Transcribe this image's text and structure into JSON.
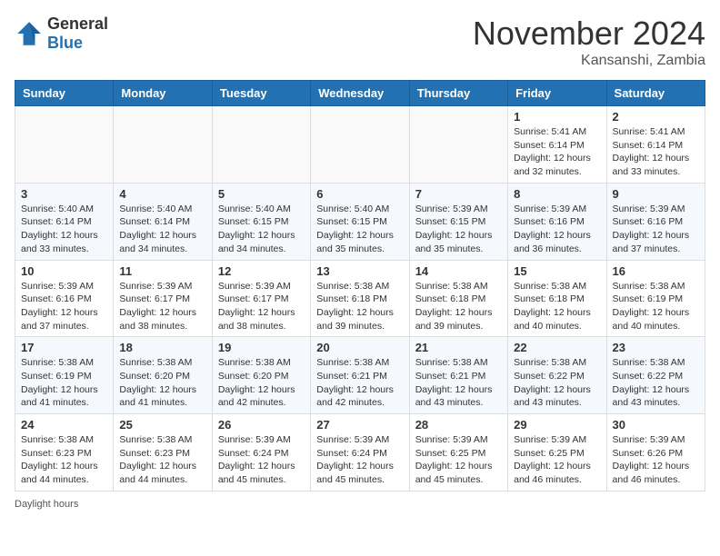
{
  "header": {
    "logo_general": "General",
    "logo_blue": "Blue",
    "month_year": "November 2024",
    "location": "Kansanshi, Zambia"
  },
  "days_of_week": [
    "Sunday",
    "Monday",
    "Tuesday",
    "Wednesday",
    "Thursday",
    "Friday",
    "Saturday"
  ],
  "footer": {
    "note": "Daylight hours"
  },
  "weeks": [
    [
      {
        "day": "",
        "info": ""
      },
      {
        "day": "",
        "info": ""
      },
      {
        "day": "",
        "info": ""
      },
      {
        "day": "",
        "info": ""
      },
      {
        "day": "",
        "info": ""
      },
      {
        "day": "1",
        "info": "Sunrise: 5:41 AM\nSunset: 6:14 PM\nDaylight: 12 hours and 32 minutes."
      },
      {
        "day": "2",
        "info": "Sunrise: 5:41 AM\nSunset: 6:14 PM\nDaylight: 12 hours and 33 minutes."
      }
    ],
    [
      {
        "day": "3",
        "info": "Sunrise: 5:40 AM\nSunset: 6:14 PM\nDaylight: 12 hours and 33 minutes."
      },
      {
        "day": "4",
        "info": "Sunrise: 5:40 AM\nSunset: 6:14 PM\nDaylight: 12 hours and 34 minutes."
      },
      {
        "day": "5",
        "info": "Sunrise: 5:40 AM\nSunset: 6:15 PM\nDaylight: 12 hours and 34 minutes."
      },
      {
        "day": "6",
        "info": "Sunrise: 5:40 AM\nSunset: 6:15 PM\nDaylight: 12 hours and 35 minutes."
      },
      {
        "day": "7",
        "info": "Sunrise: 5:39 AM\nSunset: 6:15 PM\nDaylight: 12 hours and 35 minutes."
      },
      {
        "day": "8",
        "info": "Sunrise: 5:39 AM\nSunset: 6:16 PM\nDaylight: 12 hours and 36 minutes."
      },
      {
        "day": "9",
        "info": "Sunrise: 5:39 AM\nSunset: 6:16 PM\nDaylight: 12 hours and 37 minutes."
      }
    ],
    [
      {
        "day": "10",
        "info": "Sunrise: 5:39 AM\nSunset: 6:16 PM\nDaylight: 12 hours and 37 minutes."
      },
      {
        "day": "11",
        "info": "Sunrise: 5:39 AM\nSunset: 6:17 PM\nDaylight: 12 hours and 38 minutes."
      },
      {
        "day": "12",
        "info": "Sunrise: 5:39 AM\nSunset: 6:17 PM\nDaylight: 12 hours and 38 minutes."
      },
      {
        "day": "13",
        "info": "Sunrise: 5:38 AM\nSunset: 6:18 PM\nDaylight: 12 hours and 39 minutes."
      },
      {
        "day": "14",
        "info": "Sunrise: 5:38 AM\nSunset: 6:18 PM\nDaylight: 12 hours and 39 minutes."
      },
      {
        "day": "15",
        "info": "Sunrise: 5:38 AM\nSunset: 6:18 PM\nDaylight: 12 hours and 40 minutes."
      },
      {
        "day": "16",
        "info": "Sunrise: 5:38 AM\nSunset: 6:19 PM\nDaylight: 12 hours and 40 minutes."
      }
    ],
    [
      {
        "day": "17",
        "info": "Sunrise: 5:38 AM\nSunset: 6:19 PM\nDaylight: 12 hours and 41 minutes."
      },
      {
        "day": "18",
        "info": "Sunrise: 5:38 AM\nSunset: 6:20 PM\nDaylight: 12 hours and 41 minutes."
      },
      {
        "day": "19",
        "info": "Sunrise: 5:38 AM\nSunset: 6:20 PM\nDaylight: 12 hours and 42 minutes."
      },
      {
        "day": "20",
        "info": "Sunrise: 5:38 AM\nSunset: 6:21 PM\nDaylight: 12 hours and 42 minutes."
      },
      {
        "day": "21",
        "info": "Sunrise: 5:38 AM\nSunset: 6:21 PM\nDaylight: 12 hours and 43 minutes."
      },
      {
        "day": "22",
        "info": "Sunrise: 5:38 AM\nSunset: 6:22 PM\nDaylight: 12 hours and 43 minutes."
      },
      {
        "day": "23",
        "info": "Sunrise: 5:38 AM\nSunset: 6:22 PM\nDaylight: 12 hours and 43 minutes."
      }
    ],
    [
      {
        "day": "24",
        "info": "Sunrise: 5:38 AM\nSunset: 6:23 PM\nDaylight: 12 hours and 44 minutes."
      },
      {
        "day": "25",
        "info": "Sunrise: 5:38 AM\nSunset: 6:23 PM\nDaylight: 12 hours and 44 minutes."
      },
      {
        "day": "26",
        "info": "Sunrise: 5:39 AM\nSunset: 6:24 PM\nDaylight: 12 hours and 45 minutes."
      },
      {
        "day": "27",
        "info": "Sunrise: 5:39 AM\nSunset: 6:24 PM\nDaylight: 12 hours and 45 minutes."
      },
      {
        "day": "28",
        "info": "Sunrise: 5:39 AM\nSunset: 6:25 PM\nDaylight: 12 hours and 45 minutes."
      },
      {
        "day": "29",
        "info": "Sunrise: 5:39 AM\nSunset: 6:25 PM\nDaylight: 12 hours and 46 minutes."
      },
      {
        "day": "30",
        "info": "Sunrise: 5:39 AM\nSunset: 6:26 PM\nDaylight: 12 hours and 46 minutes."
      }
    ]
  ]
}
